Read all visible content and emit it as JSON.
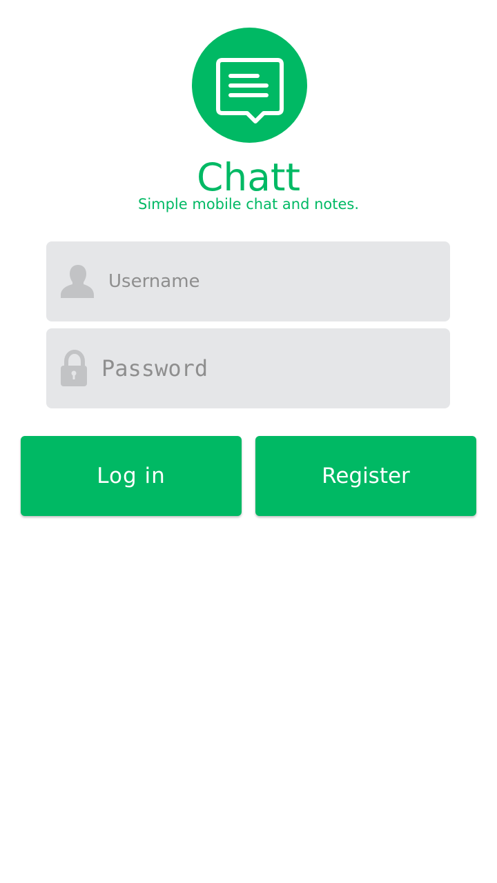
{
  "app": {
    "title": "Chatt",
    "subtitle": "Simple mobile chat and notes.",
    "logo_icon": "chat-bubble-icon"
  },
  "form": {
    "username": {
      "placeholder": "Username",
      "value": "",
      "icon": "user-icon"
    },
    "password": {
      "placeholder": "Password",
      "value": "",
      "icon": "lock-icon"
    }
  },
  "buttons": {
    "login_label": "Log in",
    "register_label": "Register"
  },
  "colors": {
    "accent": "#00b964",
    "field_bg": "#e5e6e8",
    "icon_gray": "#c2c3c5",
    "placeholder": "#8e8e8e"
  }
}
